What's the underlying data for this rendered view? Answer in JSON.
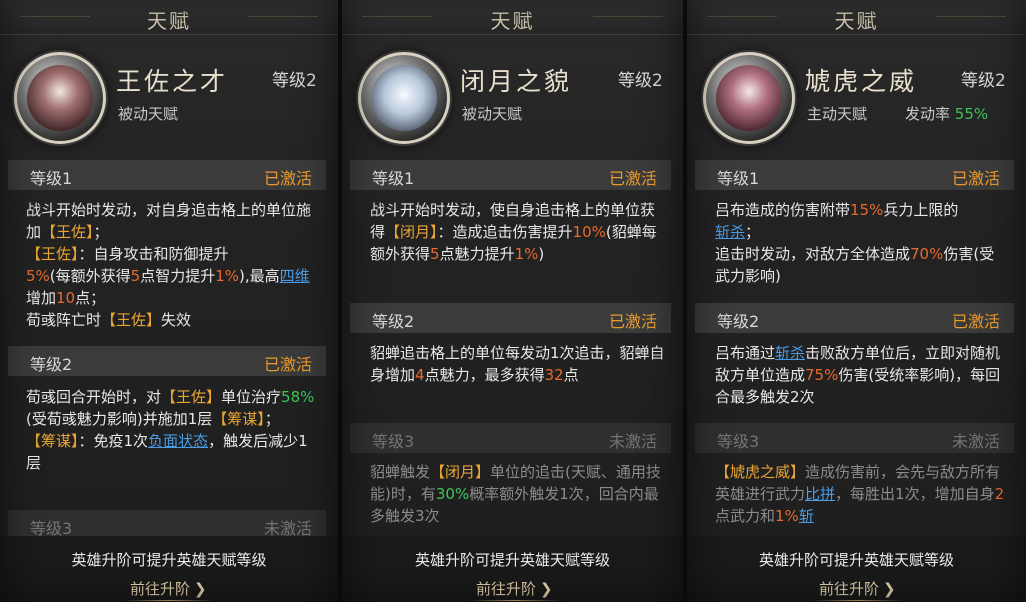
{
  "panels": [
    {
      "title": "天赋",
      "name": "王佐之才",
      "level": "等级2",
      "type": "被动天赋",
      "sections": [
        {
          "level": "等级1",
          "status": "已激活"
        },
        {
          "level": "等级2",
          "status": "已激活"
        },
        {
          "level": "等级3",
          "status": "未激活"
        }
      ]
    },
    {
      "title": "天赋",
      "name": "闭月之貌",
      "level": "等级2",
      "type": "被动天赋",
      "sections": [
        {
          "level": "等级1",
          "status": "已激活"
        },
        {
          "level": "等级2",
          "status": "已激活"
        },
        {
          "level": "等级3",
          "status": "未激活"
        }
      ]
    },
    {
      "title": "天赋",
      "name": "虓虎之威",
      "level": "等级2",
      "type": "主动天赋",
      "trigger_label": "发动率",
      "trigger_value": "55%",
      "sections": [
        {
          "level": "等级1",
          "status": "已激活"
        },
        {
          "level": "等级2",
          "status": "已激活"
        },
        {
          "level": "等级3",
          "status": "未激活"
        }
      ]
    }
  ],
  "footer": {
    "note": "英雄升阶可提升英雄天赋等级",
    "link": "前往升阶"
  },
  "desc": {
    "p1": {
      "l1": [
        "战斗开始时发动，对自身追击格上的单位施加",
        "【王佐】",
        "；"
      ],
      "l1b": [
        "【王佐】",
        "：自身攻击和防御提升",
        "5%",
        "(每额外获得",
        "5",
        "点智力提升",
        "1%",
        "),最高",
        "四维",
        "增加",
        "10",
        "点；",
        "荀彧阵亡时",
        "【王佐】",
        "失效"
      ],
      "l2": [
        "荀彧回合开始时，对",
        "【王佐】",
        "单位治疗",
        "58%",
        "(受荀彧魅力影响)并施加1层",
        "【筹谋】",
        "；",
        "【筹谋】",
        "：免疫1次",
        "负面状态",
        "，触发后减少1层"
      ]
    },
    "p2": {
      "l1": [
        "战斗开始时发动，使自身追击格上的单位获得",
        "【闭月】",
        "：造成追击伤害提升",
        "10%",
        "(貂蝉每额外获得",
        "5",
        "点魅力提升",
        "1%",
        ")"
      ],
      "l2": [
        "貂蝉追击格上的单位每发动1次追击，貂蝉自身增加",
        "4",
        "点魅力，最多获得",
        "32",
        "点"
      ],
      "l3": [
        "貂蝉触发",
        "【闭月】",
        "单位的追击(天赋、通用技能)时，有",
        "30%",
        "概率额外触发1次，回合内最多触发3次"
      ]
    },
    "p3": {
      "l1": [
        "吕布造成的伤害附带",
        "15%",
        "兵力上限的",
        "斩杀",
        "；",
        "追击时发动，对敌方全体造成",
        "70%",
        "伤害(受武力影响)"
      ],
      "l2": [
        "吕布通过",
        "斩杀",
        "击败敌方单位后，立即对随机敌方单位造成",
        "75%",
        "伤害(受统率影响)，每回合最多触发2次"
      ],
      "l3": [
        "【虓虎之威】",
        "造成伤害前，会先与敌方所有英雄进行武力",
        "比拼",
        "，每胜出1次，增加自身",
        "2",
        "点武力和",
        "1%",
        "斩"
      ]
    }
  },
  "colors": {
    "active": "#e89a2c",
    "inactive": "#8a8a8a",
    "highlight_orange": "#e86a2c",
    "highlight_yellow": "#e8a534",
    "highlight_green": "#3ec45a",
    "link_blue": "#4a9ce6"
  }
}
